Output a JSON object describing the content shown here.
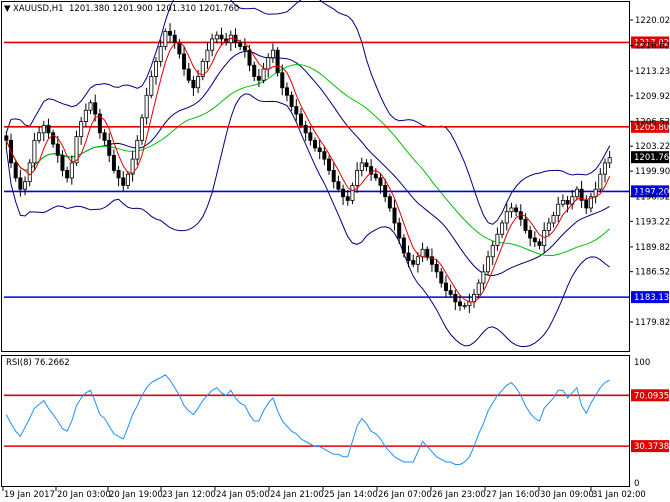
{
  "header": {
    "symbol_label": "XAUUSD,H1",
    "ohlc": "1201.380 1201.900 1201.310 1201.760",
    "menu_glyph": "▼"
  },
  "price_axis": {
    "ticks": [
      "1220.020",
      "1216.625",
      "1213.230",
      "1209.920",
      "1206.525",
      "1203.220",
      "1199.900",
      "1196.520",
      "1193.220",
      "1189.820",
      "1186.520",
      "1179.820"
    ],
    "current_price": "1201.760"
  },
  "horizontal_lines": [
    {
      "label": "1217.028",
      "color": "#e00000"
    },
    {
      "label": "1205.802",
      "color": "#e00000"
    },
    {
      "label": "1197.205",
      "color": "#0000e0"
    },
    {
      "label": "1183.132",
      "color": "#0000e0"
    }
  ],
  "rsi_panel": {
    "label": "RSI(8) 76.2662",
    "scale_top": "100",
    "scale_bottom": "0",
    "level_high": "70.0935",
    "level_low": "30.3738"
  },
  "time_axis": [
    "19 Jan 2017",
    "20 Jan 03:00",
    "20 Jan 19:00",
    "23 Jan 12:00",
    "24 Jan 05:00",
    "24 Jan 21:00",
    "25 Jan 14:00",
    "26 Jan 07:00",
    "26 Jan 23:00",
    "27 Jan 16:00",
    "30 Jan 09:00",
    "31 Jan 02:00"
  ],
  "colors": {
    "bull_candle": "#ffffff",
    "bear_candle": "#000000",
    "ema_fast": "#e00000",
    "ma_slow": "#00c000",
    "bollinger": "#000080",
    "rsi_line": "#1e90ff",
    "level_red": "#e00000",
    "level_blue": "#0000e0"
  },
  "chart_data": {
    "type": "candlestick",
    "closes": [
      1204,
      1201,
      1199,
      1197.5,
      1198.5,
      1201,
      1204,
      1205,
      1206,
      1205,
      1203.5,
      1202,
      1200,
      1199,
      1201,
      1204.5,
      1206.5,
      1208,
      1209,
      1207.5,
      1205,
      1204,
      1202,
      1200,
      1199,
      1198,
      1199.5,
      1201.5,
      1204,
      1207,
      1210,
      1212.5,
      1214.5,
      1216.5,
      1218.5,
      1218,
      1217,
      1215.5,
      1213.5,
      1212,
      1211,
      1212.5,
      1214.5,
      1216,
      1217.5,
      1218,
      1217.5,
      1217,
      1218,
      1217,
      1216.5,
      1216,
      1214,
      1212.5,
      1212,
      1213.5,
      1215,
      1216,
      1213,
      1211,
      1210,
      1208.5,
      1207.5,
      1206,
      1205,
      1204,
      1203,
      1202.5,
      1201.5,
      1200,
      1198.5,
      1197.5,
      1196.5,
      1196,
      1198,
      1200,
      1201,
      1200.5,
      1199.5,
      1199,
      1198,
      1196.5,
      1195,
      1193,
      1191,
      1189,
      1188,
      1187.5,
      1188.5,
      1189.5,
      1188.5,
      1187.5,
      1186.5,
      1185,
      1184,
      1183.5,
      1182.5,
      1182,
      1182,
      1182.5,
      1183.5,
      1185,
      1186.5,
      1188.5,
      1190,
      1191.5,
      1193,
      1194.5,
      1195,
      1194.5,
      1193.5,
      1192,
      1191,
      1190.5,
      1190,
      1192,
      1193,
      1194,
      1195.5,
      1196,
      1195.5,
      1196.5,
      1197.5,
      1196,
      1195,
      1196.5,
      1197.5,
      1199.5,
      1201,
      1201.7
    ],
    "rsi": [
      55,
      48,
      42,
      38,
      45,
      52,
      60,
      63,
      66,
      60,
      55,
      50,
      44,
      42,
      50,
      62,
      68,
      72,
      74,
      65,
      55,
      52,
      46,
      40,
      38,
      36,
      45,
      55,
      62,
      70,
      76,
      80,
      82,
      84,
      86,
      82,
      76,
      70,
      62,
      58,
      55,
      60,
      66,
      70,
      74,
      76,
      72,
      70,
      74,
      68,
      64,
      62,
      55,
      50,
      50,
      58,
      64,
      68,
      58,
      50,
      46,
      42,
      40,
      36,
      34,
      32,
      30,
      30,
      28,
      26,
      24,
      24,
      22,
      22,
      34,
      46,
      52,
      48,
      42,
      40,
      36,
      30,
      26,
      22,
      20,
      18,
      18,
      18,
      26,
      34,
      30,
      26,
      22,
      20,
      18,
      18,
      16,
      16,
      18,
      22,
      30,
      40,
      48,
      58,
      64,
      70,
      74,
      78,
      80,
      76,
      70,
      62,
      56,
      52,
      50,
      60,
      64,
      68,
      74,
      74,
      68,
      72,
      76,
      62,
      56,
      64,
      70,
      76,
      80,
      82
    ]
  }
}
